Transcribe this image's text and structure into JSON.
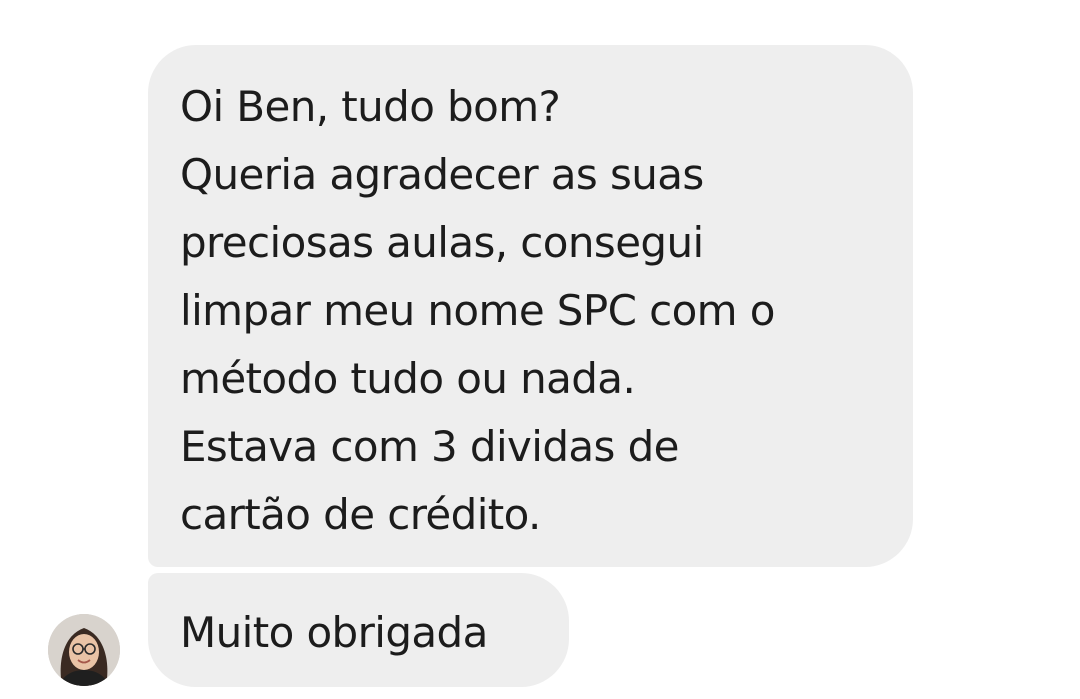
{
  "conversation": {
    "messages": [
      {
        "lines": [
          "Oi Ben, tudo bom?",
          "Queria agradecer as suas",
          "preciosas aulas, consegui",
          "limpar meu nome SPC com o",
          "método tudo ou nada.",
          "Estava com 3 dividas de",
          "cartão de crédito."
        ]
      },
      {
        "lines": [
          "Muito obrigada"
        ]
      }
    ],
    "sender_avatar_icon": "user-avatar-photo"
  },
  "colors": {
    "background": "#ffffff",
    "bubble": "#eeeeee",
    "text": "#1c1c1c"
  }
}
